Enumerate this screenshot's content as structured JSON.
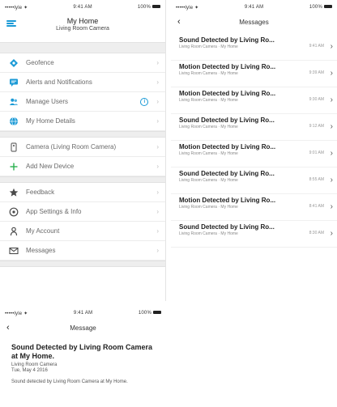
{
  "menu_panel": {
    "status": {
      "carrier": "•••••lyle ✦",
      "time": "9:41 AM",
      "battery": "100%"
    },
    "title": "My Home",
    "subtitle": "Living Room Camera",
    "groups": [
      [
        {
          "label": "Geofence",
          "icon": "geofence-icon",
          "color": "#1b9ad6"
        },
        {
          "label": "Alerts and Notifications",
          "icon": "chat-icon",
          "color": "#1b9ad6"
        },
        {
          "label": "Manage Users",
          "icon": "users-icon",
          "color": "#1b9ad6",
          "badge": "i"
        },
        {
          "label": "My Home Details",
          "icon": "globe-icon",
          "color": "#1b9ad6"
        }
      ],
      [
        {
          "label": "Camera (Living Room Camera)",
          "icon": "camera-icon",
          "color": "#6a6a6a"
        },
        {
          "label": "Add New Device",
          "icon": "plus-icon",
          "color": "#2ab04f"
        }
      ],
      [
        {
          "label": "Feedback",
          "icon": "star-icon",
          "color": "#4a4a4a"
        },
        {
          "label": "App Settings & Info",
          "icon": "info-circle-icon",
          "color": "#4a4a4a"
        },
        {
          "label": "My Account",
          "icon": "person-icon",
          "color": "#4a4a4a"
        },
        {
          "label": "Messages",
          "icon": "envelope-icon",
          "color": "#4a4a4a"
        }
      ]
    ]
  },
  "messages_panel": {
    "status": {
      "carrier": "•••••lyle ✦",
      "time": "9:41 AM",
      "battery": "100%"
    },
    "title": "Messages",
    "items": [
      {
        "title": "Sound Detected by Living Ro...",
        "sub": "Living Room Camera · My Home",
        "time": "9:41 AM"
      },
      {
        "title": "Motion Detected by Living Ro...",
        "sub": "Living Room Camera · My Home",
        "time": "9:39 AM"
      },
      {
        "title": "Motion Detected by Living Ro...",
        "sub": "Living Room Camera · My Home",
        "time": "9:30 AM"
      },
      {
        "title": "Sound Detected by Living Ro...",
        "sub": "Living Room Camera · My Home",
        "time": "9:12 AM"
      },
      {
        "title": "Motion Detected by Living Ro...",
        "sub": "Living Room Camera · My Home",
        "time": "9:01 AM"
      },
      {
        "title": "Sound Detected by Living Ro...",
        "sub": "Living Room Camera · My Home",
        "time": "8:55 AM"
      },
      {
        "title": "Motion Detected by Living Ro...",
        "sub": "Living Room Camera · My Home",
        "time": "8:41 AM"
      },
      {
        "title": "Sound Detected by Living Ro...",
        "sub": "Living Room Camera · My Home",
        "time": "8:30 AM"
      }
    ]
  },
  "detail_panel": {
    "status": {
      "carrier": "•••••lyle ✦",
      "time": "9:41 AM",
      "battery": "100%"
    },
    "title": "Message",
    "heading": "Sound Detected by Living Room Camera at My Home.",
    "device": "Living Room Camera",
    "date": "Tue, May 4 2016",
    "body": "Sound detected by Living Room Camera at My Home."
  }
}
